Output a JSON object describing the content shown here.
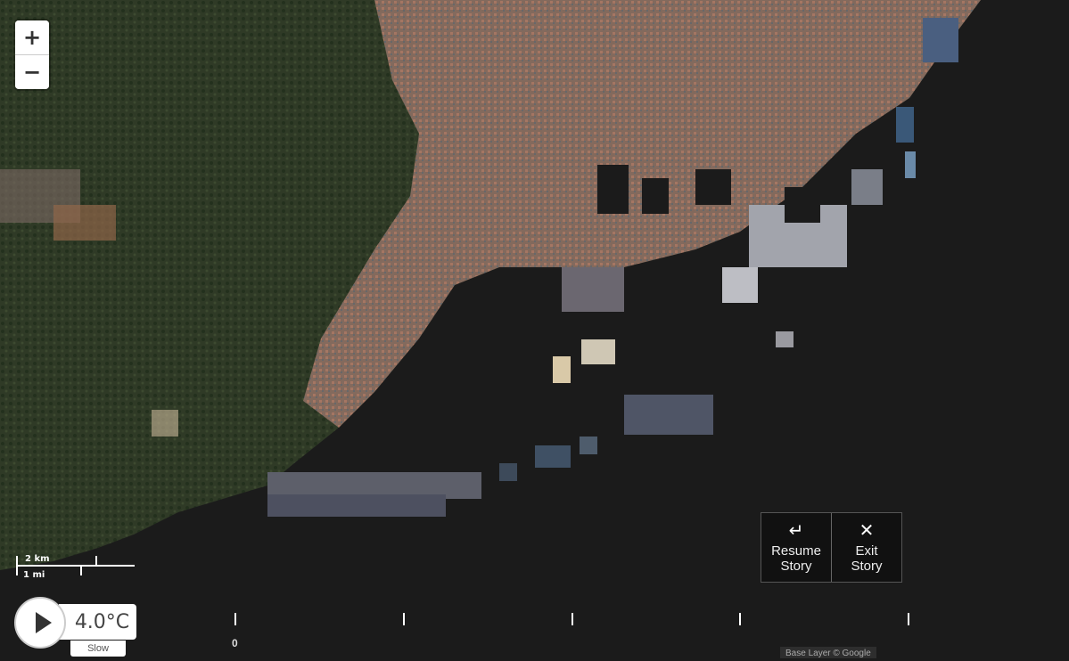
{
  "zoom": {
    "in_label": "+",
    "out_label": "−"
  },
  "scale": {
    "metric": "2 km",
    "imperial": "1 mi"
  },
  "story": {
    "resume_icon": "↵",
    "resume_label": "Resume Story",
    "exit_icon": "✕",
    "exit_label": "Exit Story"
  },
  "player": {
    "temperature": "4.0°C",
    "speed": "Slow"
  },
  "timeline": {
    "start_label": "0"
  },
  "attribution": "Base Layer © Google",
  "colors": {
    "sea": "#1b1b1b",
    "land_forest": "#2e3a24",
    "urban": "#8a6a60"
  }
}
